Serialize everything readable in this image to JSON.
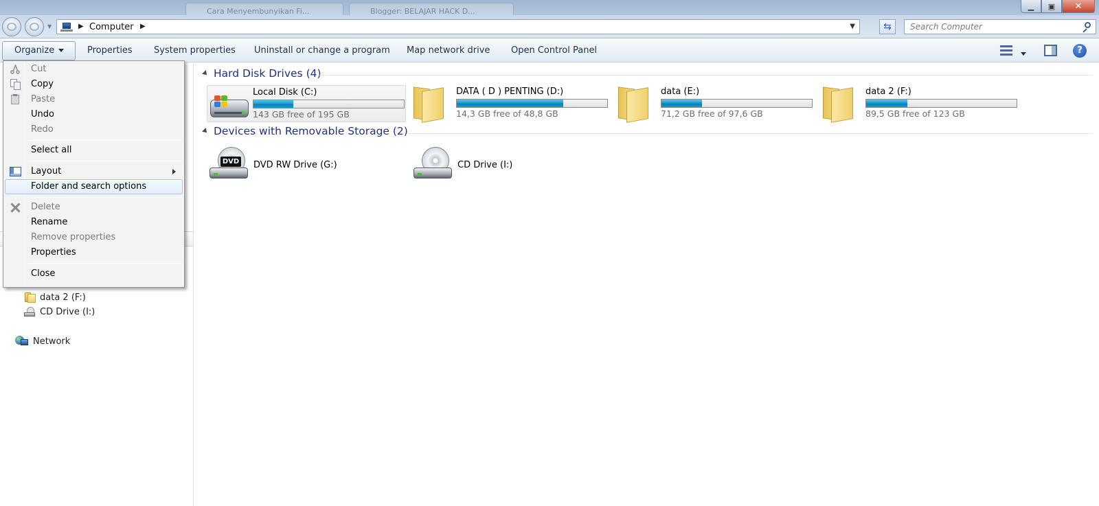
{
  "window": {
    "bg_tabs": [
      "Cara Menyembunyikan Fi...",
      "Blogger: BELAJAR HACK D..."
    ],
    "minimize": "▁",
    "maximize": "▣",
    "close": "✕"
  },
  "address": {
    "crumb": "Computer",
    "search_placeholder": "Search Computer"
  },
  "toolbar": {
    "organize": "Organize",
    "properties": "Properties",
    "system_properties": "System properties",
    "uninstall": "Uninstall or change a program",
    "map_drive": "Map network drive",
    "control_panel": "Open Control Panel",
    "help": "?"
  },
  "menu": {
    "cut": "Cut",
    "copy": "Copy",
    "paste": "Paste",
    "undo": "Undo",
    "redo": "Redo",
    "select_all": "Select all",
    "layout": "Layout",
    "folder_options": "Folder and search options",
    "delete": "Delete",
    "rename": "Rename",
    "remove_properties": "Remove properties",
    "properties": "Properties",
    "close": "Close"
  },
  "nav": {
    "data2": "data 2 (F:)",
    "cd": "CD Drive (I:)",
    "network": "Network"
  },
  "content": {
    "hdd_header": "Hard Disk Drives (4)",
    "removable_header": "Devices with Removable Storage (2)",
    "drives": [
      {
        "name": "Local Disk (C:)",
        "free": "143 GB free of 195 GB",
        "used_fraction": 0.267
      },
      {
        "name": "DATA ( D ) PENTING  (D:)",
        "free": "14,3 GB free of 48,8 GB",
        "used_fraction": 0.707
      },
      {
        "name": "data (E:)",
        "free": "71,2 GB free of 97,6 GB",
        "used_fraction": 0.27
      },
      {
        "name": "data 2 (F:)",
        "free": "89,5 GB free of 123 GB",
        "used_fraction": 0.272
      }
    ],
    "devices": [
      {
        "name": "DVD RW Drive (G:)",
        "disc_label": "DVD"
      },
      {
        "name": "CD Drive (I:)"
      }
    ]
  },
  "colors": {
    "group_header": "#1e3287",
    "capacity_fill": "#1d9cd1",
    "menu_highlight": "#e4eefb"
  }
}
